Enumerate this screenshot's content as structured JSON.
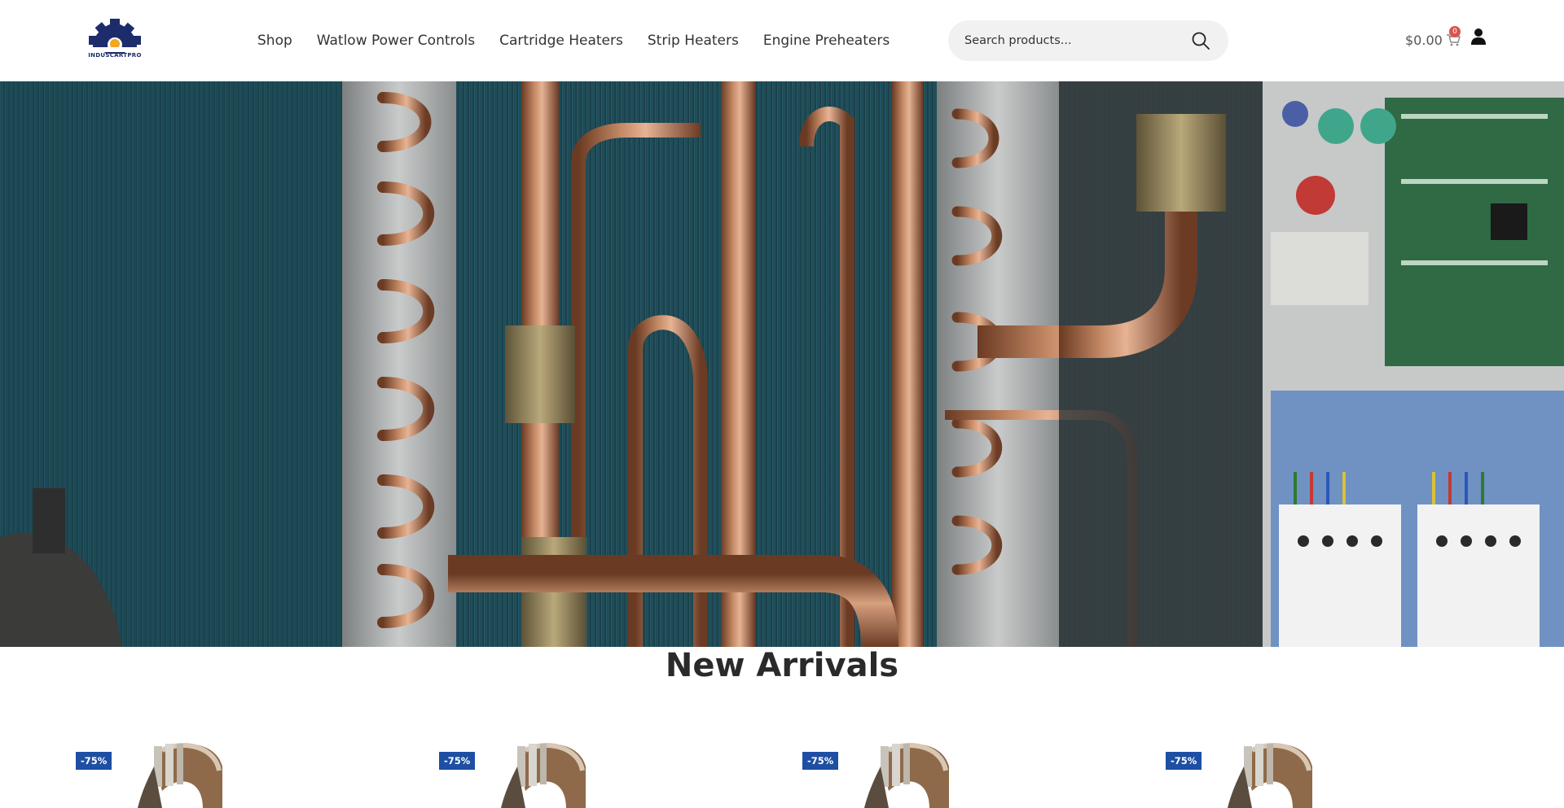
{
  "header": {
    "logo_text": "INDUSCARTPRO",
    "nav": [
      "Shop",
      "Watlow Power Controls",
      "Cartridge Heaters",
      "Strip Heaters",
      "Engine Preheaters"
    ],
    "search": {
      "placeholder": "Search products..."
    },
    "cart": {
      "amount": "$0.00",
      "count": "0"
    }
  },
  "hero": {
    "image": "industrial copper piping and control panel"
  },
  "new_arrivals": {
    "title": "New Arrivals",
    "products": [
      {
        "badge": "-75%"
      },
      {
        "badge": "-75%"
      },
      {
        "badge": "-75%"
      },
      {
        "badge": "-75%"
      }
    ]
  },
  "colors": {
    "brand_navy": "#1d2c6b",
    "accent_orange": "#f5a623",
    "badge_blue": "#1e4fa3",
    "cart_badge_red": "#d9534f"
  }
}
